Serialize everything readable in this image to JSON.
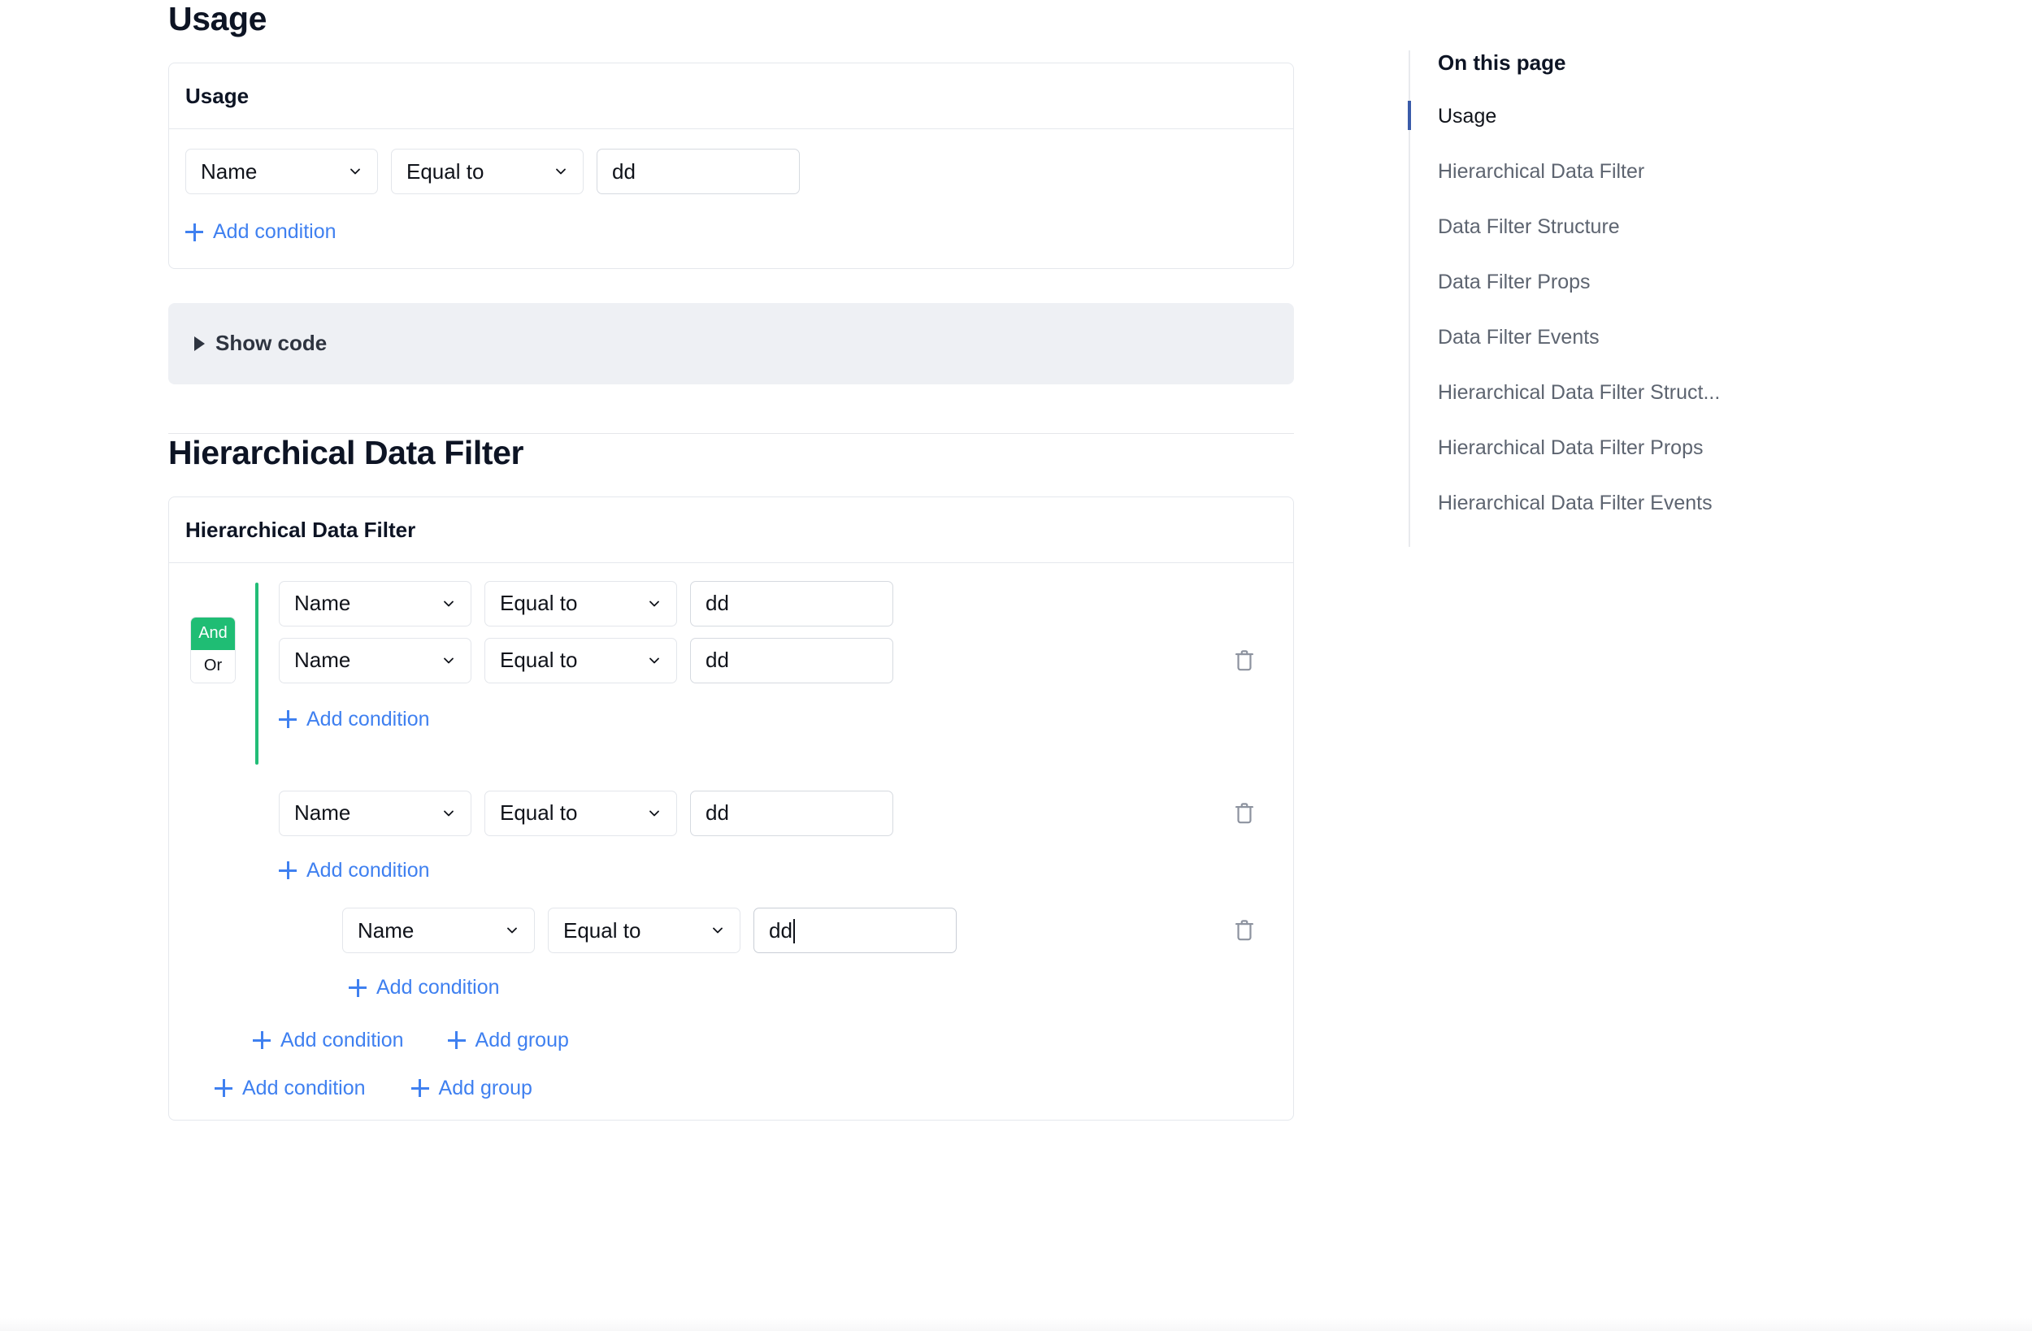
{
  "usage": {
    "heading": "Usage",
    "card_title": "Usage",
    "condition": {
      "field": "Name",
      "operator": "Equal to",
      "value": "dd"
    },
    "add_condition_label": "Add condition",
    "show_code_label": "Show code"
  },
  "hierarchical": {
    "heading": "Hierarchical Data Filter",
    "card_title": "Hierarchical Data Filter",
    "logic_toggle": {
      "and_label": "And",
      "or_label": "Or",
      "active": "And"
    },
    "rows": [
      {
        "field": "Name",
        "operator": "Equal to",
        "value": "dd",
        "has_caret": false,
        "has_trash": false
      },
      {
        "field": "Name",
        "operator": "Equal to",
        "value": "dd",
        "has_caret": false,
        "has_trash": true
      },
      {
        "field": "Name",
        "operator": "Equal to",
        "value": "dd",
        "has_caret": false,
        "has_trash": true
      },
      {
        "field": "Name",
        "operator": "Equal to",
        "value": "dd",
        "has_caret": true,
        "has_trash": true
      }
    ],
    "add_condition_label": "Add condition",
    "add_group_label": "Add group"
  },
  "toc": {
    "title": "On this page",
    "items": [
      {
        "label": "Usage",
        "active": true
      },
      {
        "label": "Hierarchical Data Filter",
        "active": false
      },
      {
        "label": "Data Filter Structure",
        "active": false
      },
      {
        "label": "Data Filter Props",
        "active": false
      },
      {
        "label": "Data Filter Events",
        "active": false
      },
      {
        "label": "Hierarchical Data Filter Struct...",
        "active": false
      },
      {
        "label": "Hierarchical Data Filter Props",
        "active": false
      },
      {
        "label": "Hierarchical Data Filter Events",
        "active": false
      }
    ]
  },
  "colors": {
    "accent_blue": "#3f80f0",
    "accent_green": "#1fbd74",
    "toc_active_bar": "#3a5ba9",
    "text_primary": "#0d1424",
    "text_muted": "#5d6470",
    "border": "#e5e8ed",
    "code_bg": "#eef0f4"
  }
}
